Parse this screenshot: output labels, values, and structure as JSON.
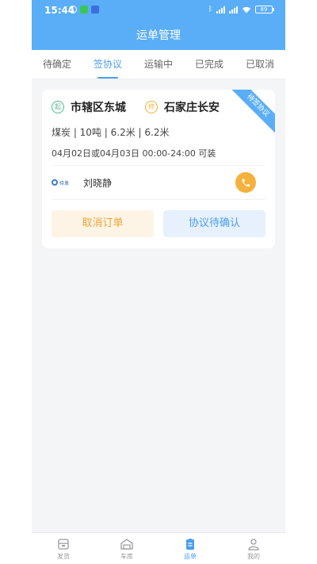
{
  "status_bar": {
    "time": "15:44",
    "battery": "89"
  },
  "header": {
    "title": "运单管理"
  },
  "tabs": [
    {
      "label": "待确定",
      "active": false
    },
    {
      "label": "签协议",
      "active": true
    },
    {
      "label": "运输中",
      "active": false
    },
    {
      "label": "已完成",
      "active": false
    },
    {
      "label": "已取消",
      "active": false
    }
  ],
  "order": {
    "ribbon": "待签协议",
    "start_pin": "起",
    "start_city": "市辖区东城",
    "end_pin": "终",
    "end_city": "石家庄长安",
    "spec": "煤炭 | 10吨 | 6.2米 | 6.2米",
    "date": "04月02日或04月03日 00:00-24:00  可装",
    "company_logo_text": "待发",
    "driver_name": "刘晓静",
    "cancel_label": "取消订单",
    "confirm_label": "协议待确认"
  },
  "colors": {
    "primary": "#5aaef7",
    "accent_orange": "#f6b03c",
    "start_green": "#48b98f"
  },
  "bottom_nav": [
    {
      "label": "发货",
      "icon": "shipment-icon",
      "active": false
    },
    {
      "label": "车库",
      "icon": "garage-icon",
      "active": false
    },
    {
      "label": "运单",
      "icon": "waybill-icon",
      "active": true
    },
    {
      "label": "我的",
      "icon": "profile-icon",
      "active": false
    }
  ]
}
